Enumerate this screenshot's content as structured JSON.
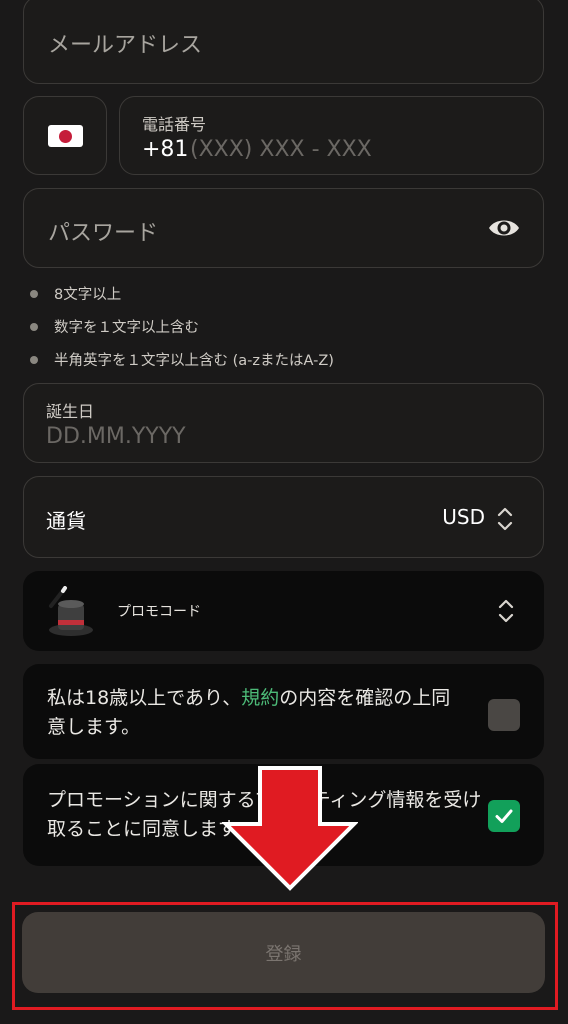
{
  "email": {
    "placeholder": "メールアドレス"
  },
  "phone": {
    "label": "電話番号",
    "prefix": "+81",
    "placeholder": "(XXX) XXX - XXX",
    "flag": "japan-flag"
  },
  "password": {
    "placeholder": "パスワード",
    "icon": "eye-icon"
  },
  "password_rules": [
    "8文字以上",
    "数字を１文字以上含む",
    "半角英字を１文字以上含む (a-zまたはA-Z)"
  ],
  "birthday": {
    "label": "誕生日",
    "placeholder": "DD.MM.YYYY"
  },
  "currency": {
    "label": "通貨",
    "value": "USD"
  },
  "promo": {
    "label": "プロモコード"
  },
  "age_consent": {
    "text_before": "私は18歳以上であり、",
    "link": "規約",
    "text_after": "の内容を確認の上同意します。",
    "checked": false
  },
  "marketing_consent": {
    "text": "プロモーションに関するマーケティング情報を受け取ることに同意します",
    "checked": true
  },
  "register_button": {
    "label": "登録"
  },
  "colors": {
    "accent_green": "#4dbb78",
    "checkbox_green": "#12a05a",
    "highlight_red": "#e01b22"
  }
}
